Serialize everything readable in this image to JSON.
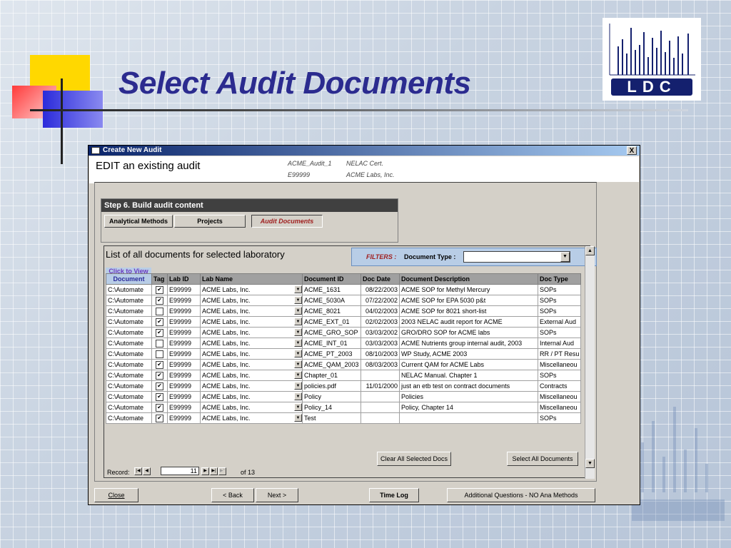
{
  "slide": {
    "title": "Select Audit Documents",
    "logo_text": "LDC"
  },
  "window": {
    "title": "Create New Audit",
    "close_glyph": "X"
  },
  "header": {
    "heading": "EDIT an existing audit",
    "audit_name": "ACME_Audit_1",
    "cert_type": "NELAC Cert.",
    "lab_id": "E99999",
    "lab_name": "ACME Labs, Inc."
  },
  "step": {
    "title": "Step 6.  Build audit content",
    "tabs": [
      {
        "label": "Analytical Methods",
        "active": false
      },
      {
        "label": "Projects",
        "active": false
      },
      {
        "label": "Audit Documents",
        "active": true
      }
    ]
  },
  "list": {
    "title": "List of all documents for selected laboratory",
    "filters_label": "FILTERS :",
    "doc_type_label": "Document Type :",
    "doc_type_value": "",
    "click_to_view_line1": "Click to View",
    "click_to_view_line2": "Document",
    "columns": [
      "Document",
      "Tag",
      "Lab ID",
      "Lab Name",
      "Document ID",
      "Doc Date",
      "Document Description",
      "Doc Type"
    ],
    "rows": [
      {
        "doc": "C:\\Automate",
        "tag": true,
        "lab_id": "E99999",
        "lab_name": "ACME Labs, Inc.",
        "doc_id": "ACME_1631",
        "date": "08/22/2003",
        "desc": "ACME SOP for Methyl Mercury",
        "type": "SOPs"
      },
      {
        "doc": "C:\\Automate",
        "tag": true,
        "lab_id": "E99999",
        "lab_name": "ACME Labs, Inc.",
        "doc_id": "ACME_5030A",
        "date": "07/22/2002",
        "desc": "ACME SOP for EPA 5030 p&t",
        "type": "SOPs"
      },
      {
        "doc": "C:\\Automate",
        "tag": false,
        "lab_id": "E99999",
        "lab_name": "ACME Labs, Inc.",
        "doc_id": "ACME_8021",
        "date": "04/02/2003",
        "desc": "ACME SOP for 8021 short-list",
        "type": "SOPs"
      },
      {
        "doc": "C:\\Automate",
        "tag": true,
        "lab_id": "E99999",
        "lab_name": "ACME Labs, Inc.",
        "doc_id": "ACME_EXT_01",
        "date": "02/02/2003",
        "desc": "2003 NELAC audit report for ACME",
        "type": "External Aud"
      },
      {
        "doc": "C:\\Automate",
        "tag": true,
        "lab_id": "E99999",
        "lab_name": "ACME Labs, Inc.",
        "doc_id": "ACME_GRO_SOP",
        "date": "03/03/2002",
        "desc": "GRO/DRO SOP for ACME labs",
        "type": "SOPs"
      },
      {
        "doc": "C:\\Automate",
        "tag": false,
        "lab_id": "E99999",
        "lab_name": "ACME Labs, Inc.",
        "doc_id": "ACME_INT_01",
        "date": "03/03/2003",
        "desc": "ACME Nutrients group internal audit, 2003",
        "type": "Internal Aud"
      },
      {
        "doc": "C:\\Automate",
        "tag": false,
        "lab_id": "E99999",
        "lab_name": "ACME Labs, Inc.",
        "doc_id": "ACME_PT_2003",
        "date": "08/10/2003",
        "desc": "WP Study, ACME 2003",
        "type": "RR / PT Resu"
      },
      {
        "doc": "C:\\Automate",
        "tag": true,
        "lab_id": "E99999",
        "lab_name": "ACME Labs, Inc.",
        "doc_id": "ACME_QAM_2003",
        "date": "08/03/2003",
        "desc": "Current QAM for ACME Labs",
        "type": "Miscellaneou"
      },
      {
        "doc": "C:\\Automate",
        "tag": true,
        "lab_id": "E99999",
        "lab_name": "ACME Labs, Inc.",
        "doc_id": "Chapter_01",
        "date": "",
        "desc": "NELAC Manual.  Chapter 1",
        "type": "SOPs"
      },
      {
        "doc": "C:\\Automate",
        "tag": true,
        "lab_id": "E99999",
        "lab_name": "ACME Labs, Inc.",
        "doc_id": "policies.pdf",
        "date": "11/01/2000",
        "desc": "just an etb test on contract documents",
        "type": "Contracts"
      },
      {
        "doc": "C:\\Automate",
        "tag": true,
        "lab_id": "E99999",
        "lab_name": "ACME Labs, Inc.",
        "doc_id": "Policy",
        "date": "",
        "desc": "Policies",
        "type": "Miscellaneou"
      },
      {
        "doc": "C:\\Automate",
        "tag": true,
        "lab_id": "E99999",
        "lab_name": "ACME Labs, Inc.",
        "doc_id": "Policy_14",
        "date": "",
        "desc": "Policy, Chapter 14",
        "type": "Miscellaneou"
      },
      {
        "doc": "C:\\Automate",
        "tag": true,
        "lab_id": "E99999",
        "lab_name": "ACME Labs, Inc.",
        "doc_id": "Test",
        "date": "",
        "desc": "",
        "type": "SOPs"
      }
    ],
    "clear_button": "Clear All Selected Docs",
    "select_all_button": "Select All Documents",
    "record_label": "Record:",
    "record_current": "11",
    "record_of": "of  13"
  },
  "footer": {
    "close": "Close",
    "back": "< Back",
    "next": "Next >",
    "time_log": "Time Log",
    "additional": "Additional Questions - NO Ana Methods"
  },
  "colors": {
    "title": "#2b2b8f",
    "titlebar_start": "#0a246a",
    "active_tab": "#a02020",
    "filters_bg": "#b8cde6"
  }
}
